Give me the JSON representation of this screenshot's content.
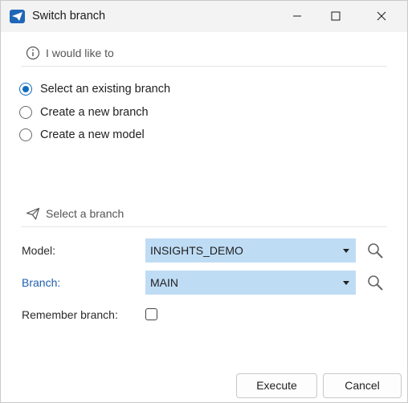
{
  "window": {
    "title": "Switch branch",
    "icon": "send-icon"
  },
  "section_intent": {
    "label": "I would like to",
    "icon": "info-icon"
  },
  "options": [
    {
      "label": "Select an existing branch",
      "selected": true
    },
    {
      "label": "Create a new branch",
      "selected": false
    },
    {
      "label": "Create a new model",
      "selected": false
    }
  ],
  "section_select": {
    "label": "Select a branch",
    "icon": "paper-plane-icon"
  },
  "form": {
    "model_label": "Model:",
    "model_value": "INSIGHTS_DEMO",
    "branch_label": "Branch:",
    "branch_value": "MAIN",
    "remember_label": "Remember branch:",
    "remember_checked": false
  },
  "footer": {
    "execute_label": "Execute",
    "cancel_label": "Cancel"
  },
  "colors": {
    "accent": "#0f6cbd",
    "select_bg": "#bfdcf5",
    "branch_label": "#1f5fb0"
  }
}
